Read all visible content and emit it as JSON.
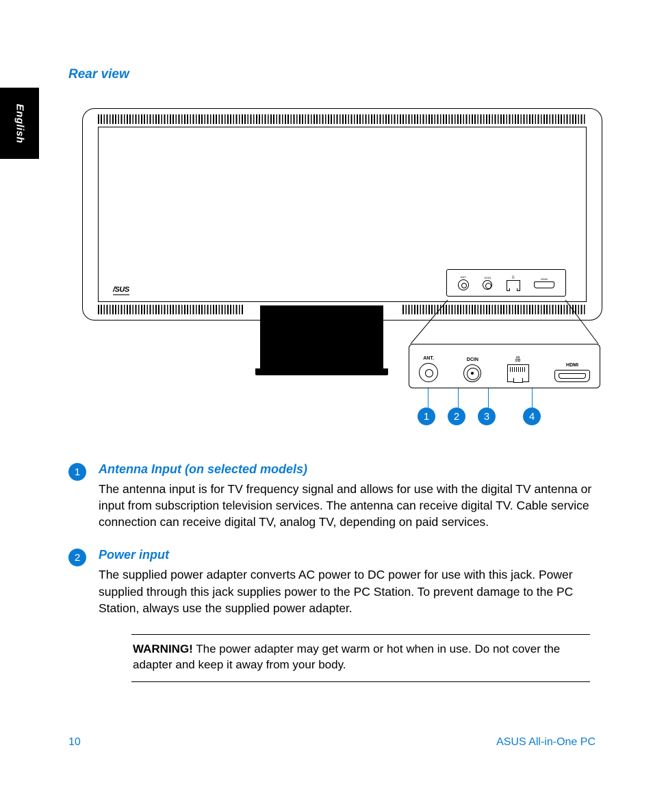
{
  "language_tab": "English",
  "section_title": "Rear view",
  "logo_text": "/SUS",
  "port_labels": {
    "ant": "ANT.",
    "dcin": "DCIN",
    "lan_icon": "品",
    "hdmi": "HDMI"
  },
  "callouts": [
    "1",
    "2",
    "3",
    "4"
  ],
  "items": [
    {
      "num": "1",
      "title": "Antenna Input (on selected models)",
      "text": "The antenna input is for TV frequency signal and allows for use with the digital TV antenna or input from subscription television services. The antenna can receive digital TV. Cable service connection can receive digital TV, analog TV, depending on paid services."
    },
    {
      "num": "2",
      "title": "Power input",
      "text": "The supplied power adapter converts AC power to DC power for use with this jack. Power supplied through this jack supplies power to the PC Station. To prevent damage to the PC Station, always use the supplied power adapter."
    }
  ],
  "warning": {
    "label": "WARNING!",
    "text": "  The power adapter may get warm or hot when in use. Do not cover the adapter and keep it away from your body."
  },
  "footer": {
    "page": "10",
    "product": "ASUS All-in-One PC"
  }
}
